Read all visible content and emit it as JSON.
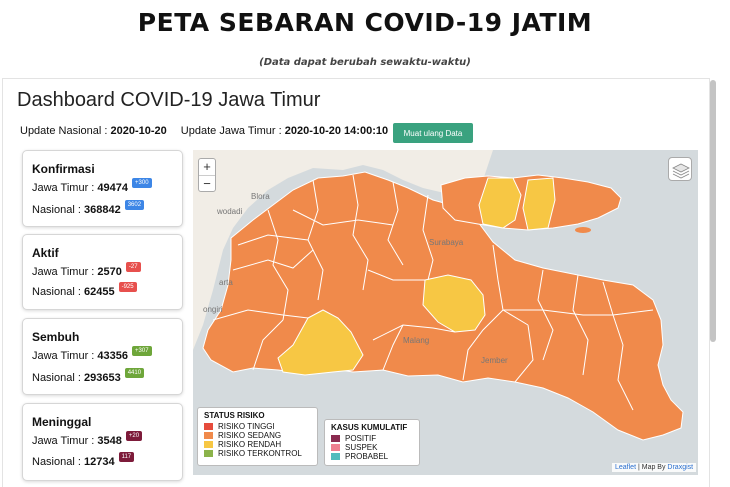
{
  "page": {
    "title": "PETA SEBARAN COVID-19 JATIM",
    "subtitle": "(Data dapat berubah sewaktu-waktu)"
  },
  "dashboard": {
    "title": "Dashboard COVID-19 Jawa Timur",
    "update_nasional_label": "Update Nasional :",
    "update_nasional_value": "2020-10-20",
    "update_jatim_label": "Update Jawa Timur :",
    "update_jatim_value": "2020-10-20 14:00:10",
    "reload_label": "Muat ulang Data"
  },
  "cards": [
    {
      "title": "Konfirmasi",
      "jatim_label": "Jawa Timur :",
      "jatim_value": "49474",
      "jatim_delta": "+300",
      "nasional_label": "Nasional :",
      "nasional_value": "368842",
      "nasional_delta": "3602"
    },
    {
      "title": "Aktif",
      "jatim_label": "Jawa Timur :",
      "jatim_value": "2570",
      "jatim_delta": "-27",
      "nasional_label": "Nasional :",
      "nasional_value": "62455",
      "nasional_delta": "-925"
    },
    {
      "title": "Sembuh",
      "jatim_label": "Jawa Timur :",
      "jatim_value": "43356",
      "jatim_delta": "+307",
      "nasional_label": "Nasional :",
      "nasional_value": "293653",
      "nasional_delta": "4410"
    },
    {
      "title": "Meninggal",
      "jatim_label": "Jawa Timur :",
      "jatim_value": "3548",
      "jatim_delta": "+20",
      "nasional_label": "Nasional :",
      "nasional_value": "12734",
      "nasional_delta": "117"
    }
  ],
  "map": {
    "zoom_in": "+",
    "zoom_out": "−",
    "labels": [
      "Blora",
      "wodadi",
      "arta",
      "ongiri",
      "Surabaya",
      "Malang",
      "Jember"
    ],
    "colors": {
      "tinggi": "#e64b3c",
      "sedang": "#f08a4b",
      "rendah": "#f7c744",
      "terkontrol": "#8bb34a",
      "land": "#f1ede6",
      "sea": "#d4dadd"
    },
    "attribution_leaflet": "Leaflet",
    "attribution_sep": " | Map By ",
    "attribution_draxgist": "Draxgist"
  },
  "legend_status": {
    "title": "STATUS RISIKO",
    "items": [
      {
        "label": "RISIKO TINGGI",
        "color": "#e64b3c"
      },
      {
        "label": "RISIKO SEDANG",
        "color": "#f08a4b"
      },
      {
        "label": "RISIKO RENDAH",
        "color": "#f7c744"
      },
      {
        "label": "RISIKO TERKONTROL",
        "color": "#8bb34a"
      }
    ]
  },
  "legend_kumulatif": {
    "title": "KASUS KUMULATIF",
    "items": [
      {
        "label": "POSITIF",
        "color": "#8a2a4f"
      },
      {
        "label": "SUSPEK",
        "color": "#ee7f90"
      },
      {
        "label": "PROBABEL",
        "color": "#52bcbd"
      }
    ]
  }
}
